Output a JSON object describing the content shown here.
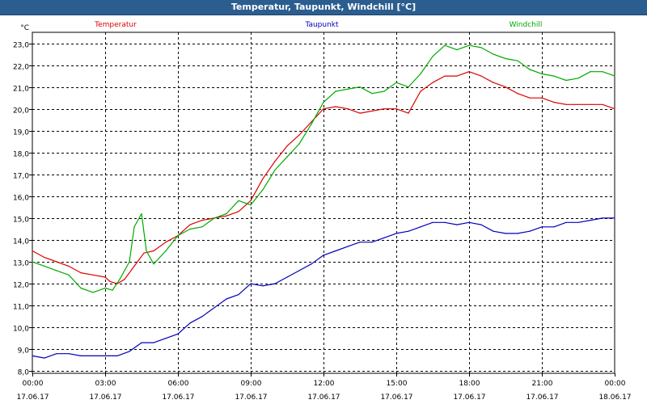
{
  "window": {
    "title": "Temperatur, Taupunkt, Windchill [°C]"
  },
  "chart_data": {
    "type": "line",
    "unit_label": "°C",
    "ylim": [
      7.9,
      23.5
    ],
    "yticks": [
      8.0,
      9.0,
      10.0,
      11.0,
      12.0,
      13.0,
      14.0,
      15.0,
      16.0,
      17.0,
      18.0,
      19.0,
      20.0,
      21.0,
      22.0,
      23.0
    ],
    "ytick_labels": [
      "8,0",
      "9,0",
      "10,0",
      "11,0",
      "12,0",
      "13,0",
      "14,0",
      "15,0",
      "16,0",
      "17,0",
      "18,0",
      "19,0",
      "20,0",
      "21,0",
      "22,0",
      "23,0"
    ],
    "xlim": [
      0,
      24
    ],
    "xticks": [
      0,
      3,
      6,
      9,
      12,
      15,
      18,
      21,
      24
    ],
    "xtick_labels": [
      [
        "00:00",
        "17.06.17"
      ],
      [
        "03:00",
        "17.06.17"
      ],
      [
        "06:00",
        "17.06.17"
      ],
      [
        "09:00",
        "17.06.17"
      ],
      [
        "12:00",
        "17.06.17"
      ],
      [
        "15:00",
        "17.06.17"
      ],
      [
        "18:00",
        "17.06.17"
      ],
      [
        "21:00",
        "17.06.17"
      ],
      [
        "00:00",
        "18.06.17"
      ]
    ],
    "grid": true,
    "legend_placement": "top",
    "series": [
      {
        "name": "Temperatur",
        "color": "#dd0000",
        "x": [
          0,
          0.5,
          1,
          1.5,
          2,
          2.5,
          3,
          3.2,
          3.5,
          3.8,
          4.2,
          4.6,
          5,
          5.5,
          6,
          6.5,
          7,
          7.5,
          8,
          8.5,
          9,
          9.5,
          10,
          10.5,
          11,
          11.5,
          12,
          12.5,
          13,
          13.5,
          14,
          14.5,
          15,
          15.5,
          16,
          16.5,
          17,
          17.5,
          18,
          18.5,
          19,
          19.5,
          20,
          20.5,
          21,
          21.5,
          22,
          22.5,
          23,
          23.5,
          24
        ],
        "values": [
          13.5,
          13.2,
          13.0,
          12.8,
          12.5,
          12.4,
          12.3,
          12.1,
          12.0,
          12.2,
          12.8,
          13.4,
          13.5,
          13.9,
          14.2,
          14.7,
          14.9,
          15.0,
          15.1,
          15.3,
          15.8,
          16.8,
          17.6,
          18.3,
          18.8,
          19.4,
          20.0,
          20.1,
          20.0,
          19.8,
          19.9,
          20.0,
          20.0,
          19.8,
          20.8,
          21.2,
          21.5,
          21.5,
          21.7,
          21.5,
          21.2,
          21.0,
          20.7,
          20.5,
          20.5,
          20.3,
          20.2,
          20.2,
          20.2,
          20.2,
          20.0
        ]
      },
      {
        "name": "Taupunkt",
        "color": "#0000bb",
        "x": [
          0,
          0.5,
          1,
          1.5,
          2,
          2.5,
          3,
          3.5,
          4,
          4.5,
          5,
          5.5,
          6,
          6.5,
          7,
          7.5,
          8,
          8.5,
          9,
          9.5,
          10,
          10.5,
          11,
          11.5,
          12,
          12.5,
          13,
          13.5,
          14,
          14.5,
          15,
          15.5,
          16,
          16.5,
          17,
          17.5,
          18,
          18.5,
          19,
          19.5,
          20,
          20.5,
          21,
          21.5,
          22,
          22.5,
          23,
          23.5,
          24
        ],
        "values": [
          8.7,
          8.6,
          8.8,
          8.8,
          8.7,
          8.7,
          8.7,
          8.7,
          8.9,
          9.3,
          9.3,
          9.5,
          9.7,
          10.2,
          10.5,
          10.9,
          11.3,
          11.5,
          12.0,
          11.9,
          12.0,
          12.3,
          12.6,
          12.9,
          13.3,
          13.5,
          13.7,
          13.9,
          13.9,
          14.1,
          14.3,
          14.4,
          14.6,
          14.8,
          14.8,
          14.7,
          14.8,
          14.7,
          14.4,
          14.3,
          14.3,
          14.4,
          14.6,
          14.6,
          14.8,
          14.8,
          14.9,
          15.0,
          15.0
        ]
      },
      {
        "name": "Windchill",
        "color": "#00aa00",
        "x": [
          0,
          0.5,
          1,
          1.5,
          2,
          2.5,
          3,
          3.3,
          3.6,
          4,
          4.2,
          4.5,
          4.7,
          5,
          5.5,
          6,
          6.5,
          7,
          7.5,
          8,
          8.5,
          9,
          9.5,
          10,
          10.5,
          11,
          11.5,
          12,
          12.5,
          13,
          13.5,
          14,
          14.5,
          15,
          15.5,
          16,
          16.5,
          17,
          17.5,
          18,
          18.5,
          19,
          19.5,
          20,
          20.5,
          21,
          21.5,
          22,
          22.5,
          23,
          23.5,
          24
        ],
        "values": [
          13.0,
          12.8,
          12.6,
          12.4,
          11.8,
          11.6,
          11.8,
          11.7,
          12.2,
          13.0,
          14.6,
          15.2,
          13.5,
          12.9,
          13.5,
          14.2,
          14.5,
          14.6,
          15.0,
          15.2,
          15.8,
          15.6,
          16.3,
          17.2,
          17.8,
          18.4,
          19.3,
          20.3,
          20.8,
          20.9,
          21.0,
          20.7,
          20.8,
          21.2,
          21.0,
          21.6,
          22.4,
          22.9,
          22.7,
          22.9,
          22.8,
          22.5,
          22.3,
          22.2,
          21.8,
          21.6,
          21.5,
          21.3,
          21.4,
          21.7,
          21.7,
          21.5
        ]
      }
    ]
  }
}
